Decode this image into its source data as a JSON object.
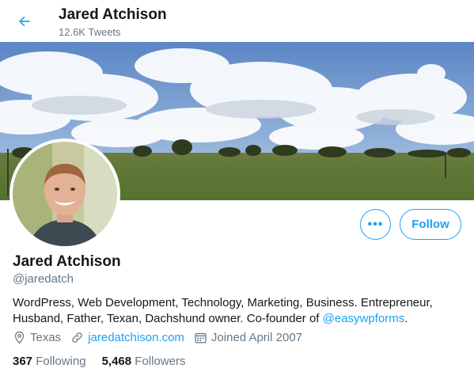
{
  "header": {
    "name": "Jared Atchison",
    "tweet_count": "12.6K Tweets"
  },
  "profile": {
    "name": "Jared Atchison",
    "handle": "@jaredatch",
    "bio_text": "WordPress, Web Development, Technology, Marketing, Business. Entrepreneur, Husband, Father, Texan, Dachshund owner. Co-founder of ",
    "bio_mention": "@easywpforms",
    "bio_end": ".",
    "location": "Texas",
    "website": "jaredatchison.com",
    "joined": "Joined April 2007"
  },
  "actions": {
    "more_label": "•••",
    "follow_label": "Follow"
  },
  "stats": {
    "following_count": "367",
    "following_label": "Following",
    "followers_count": "5,468",
    "followers_label": "Followers"
  },
  "colors": {
    "accent": "#1da1f2",
    "secondary_text": "#657786",
    "primary_text": "#14171a"
  }
}
